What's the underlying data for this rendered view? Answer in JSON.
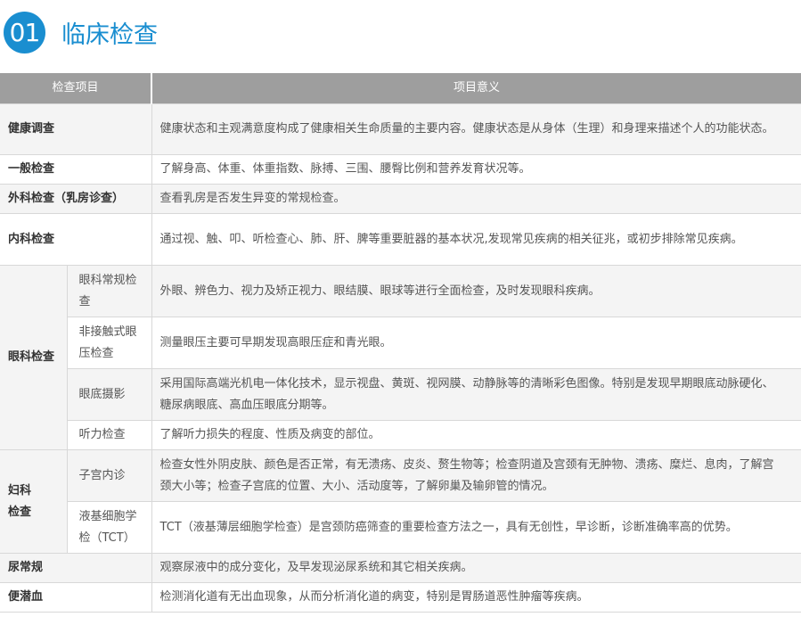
{
  "header": {
    "badge": "01",
    "title": "临床检查"
  },
  "table": {
    "columns": [
      "检查项目",
      "项目意义"
    ],
    "rows": [
      {
        "category": "健康调查",
        "meaning": "健康状态和主观满意度构成了健康相关生命质量的主要内容。健康状态是从身体（生理）和身理来描述个人的功能状态。"
      },
      {
        "category": "一般检查",
        "meaning": "了解身高、体重、体重指数、脉搏、三围、腰臀比例和营养发育状况等。"
      },
      {
        "category": "外科检查（乳房诊查）",
        "meaning": "查看乳房是否发生异变的常规检查。"
      },
      {
        "category": "内科检查",
        "meaning": "通过视、触、叩、听检查心、肺、肝、脾等重要脏器的基本状况,发现常见疾病的相关征兆，或初步排除常见疾病。"
      }
    ],
    "eye": {
      "category": "眼科检查",
      "items": [
        {
          "name": "眼科常规检查",
          "meaning": "外眼、辨色力、视力及矫正视力、眼结膜、眼球等进行全面检查，及时发现眼科疾病。"
        },
        {
          "name": "非接触式眼压检查",
          "meaning": "测量眼压主要可早期发现高眼压症和青光眼。"
        },
        {
          "name": "眼底摄影",
          "meaning": "采用国际高端光机电一体化技术，显示视盘、黄斑、视网膜、动静脉等的清晰彩色图像。特别是发现早期眼底动脉硬化、糖尿病眼底、高血压眼底分期等。"
        },
        {
          "name": "听力检查",
          "meaning": "了解听力损失的程度、性质及病变的部位。"
        }
      ]
    },
    "gyn": {
      "category_line1": "妇科",
      "category_line2": "检查",
      "items": [
        {
          "name": "子宫内诊",
          "meaning": "检查女性外阴皮肤、颜色是否正常，有无溃疡、皮炎、赘生物等；检查阴道及宫颈有无肿物、溃疡、糜烂、息肉，了解宫颈大小等；检查子宫底的位置、大小、活动度等，了解卵巢及输卵管的情况。"
        },
        {
          "name": "液基细胞学检（TCT）",
          "meaning": "TCT（液基薄层细胞学检查）是宫颈防癌筛查的重要检查方法之一，具有无创性，早诊断，诊断准确率高的优势。"
        }
      ]
    },
    "tail_rows": [
      {
        "category": "尿常规",
        "meaning": "观察尿液中的成分变化，及早发现泌尿系统和其它相关疾病。"
      },
      {
        "category": "便潜血",
        "meaning": "检测消化道有无出血现象，从而分析消化道的病变，特别是胃肠道恶性肿瘤等疾病。"
      }
    ]
  },
  "colors": {
    "accent": "#1a8ed0",
    "header_bg": "#9e9e9e",
    "row_shade": "#f4f4f4"
  }
}
